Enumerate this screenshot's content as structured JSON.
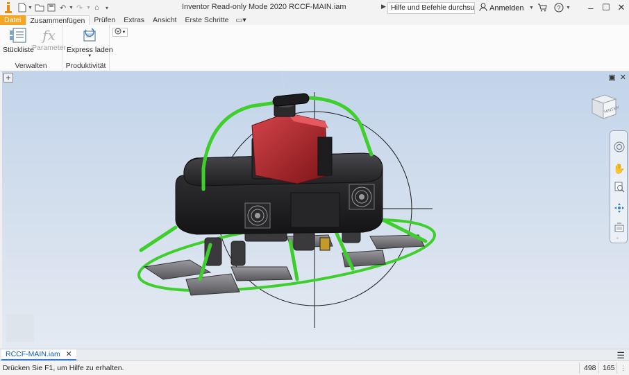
{
  "titlebar": {
    "title": "Inventor Read-only Mode 2020   RCCF-MAIN.iam",
    "search_placeholder": "Hilfe und Befehle durchsuchen...",
    "signin_label": "Anmelden"
  },
  "tabs": [
    {
      "label": "Datei"
    },
    {
      "label": "Zusammenfügen"
    },
    {
      "label": "Prüfen"
    },
    {
      "label": "Extras"
    },
    {
      "label": "Ansicht"
    },
    {
      "label": "Erste Schritte"
    }
  ],
  "ribbon": {
    "panels": [
      {
        "label": "Verwalten",
        "buttons": [
          {
            "label": "Stückliste"
          },
          {
            "label": "Parameter"
          }
        ]
      },
      {
        "label": "Produktivität",
        "buttons": [
          {
            "label": "Express laden"
          }
        ]
      }
    ]
  },
  "viewcube": {
    "face_label": "HINTEN"
  },
  "document_tab": {
    "label": "RCCF-MAIN.iam"
  },
  "statusbar": {
    "help_text": "Drücken Sie F1, um Hilfe zu erhalten.",
    "count_a": "498",
    "count_b": "165"
  },
  "colors": {
    "accent": "#f5a623",
    "frame_green": "#3fcf2c",
    "engine_red": "#b3262a",
    "housing_dark": "#2a2a2c"
  }
}
